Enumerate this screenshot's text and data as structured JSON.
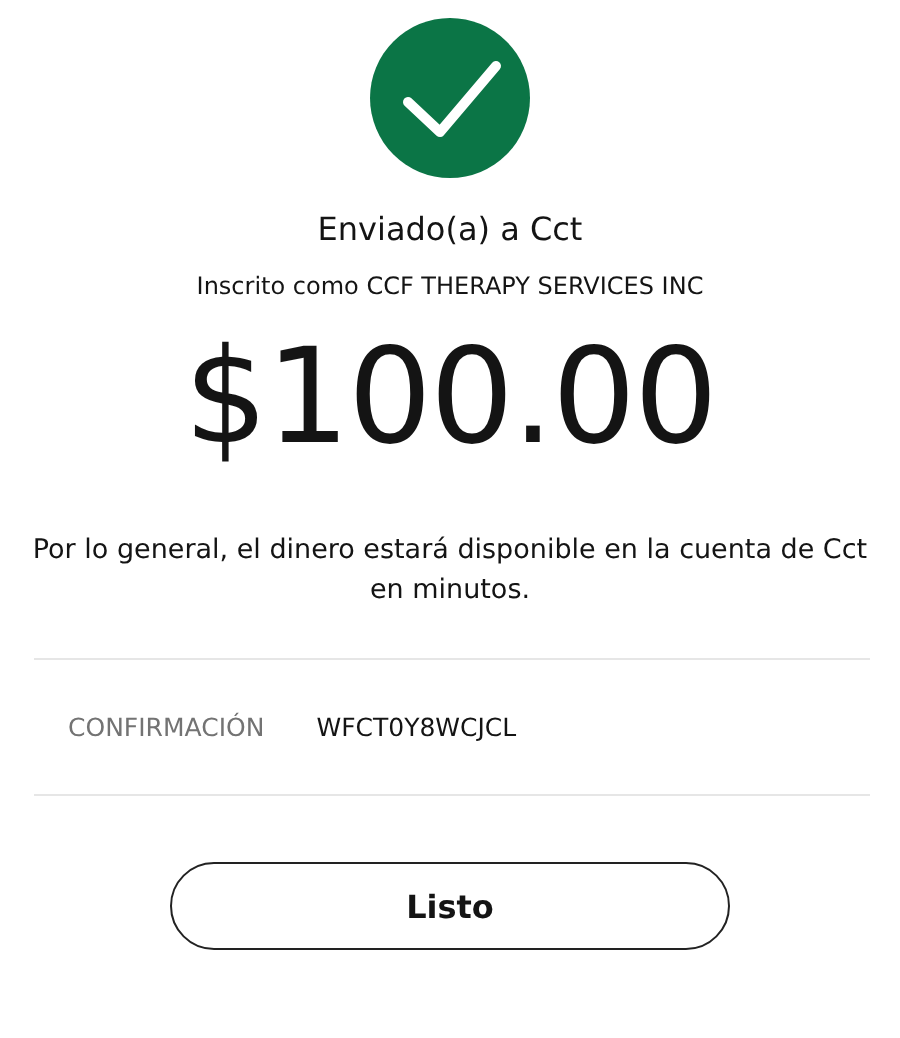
{
  "title": "Enviado(a) a Cct",
  "subtitle": "Inscrito como CCF THERAPY SERVICES INC",
  "amount": "$100.00",
  "message": "Por lo general, el dinero estará disponible en la cuenta de Cct en minutos.",
  "confirmation": {
    "label": "CONFIRMACIÓN",
    "value": "WFCT0Y8WCJCL"
  },
  "button": "Listo"
}
